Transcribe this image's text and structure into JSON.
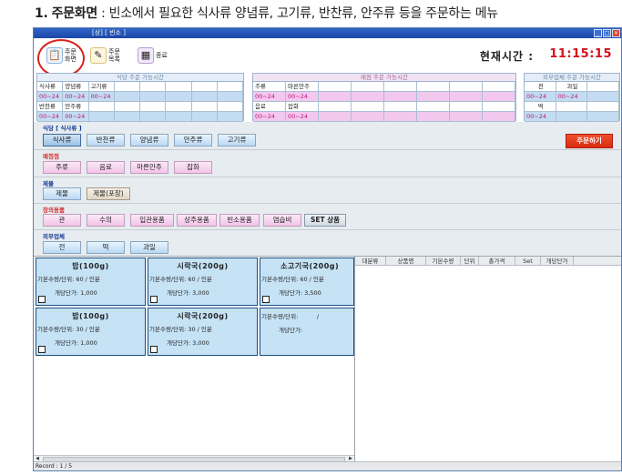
{
  "caption": {
    "number": "1.",
    "title": "주문화면",
    "separator": " : ",
    "description": "빈소에서 필요한 식사류 양념류, 고기류, 반찬류, 안주류 등을 주문하는 메뉴"
  },
  "window": {
    "title": "[상] [ 빈소 ]",
    "controls": [
      "_",
      "□",
      "×"
    ]
  },
  "toolbar": {
    "items": [
      {
        "line1": "주문",
        "line2": "화면",
        "icon": "order-screen-icon"
      },
      {
        "line1": "주문",
        "line2": "목록",
        "icon": "order-list-icon"
      },
      {
        "line1": "종료",
        "line2": "",
        "icon": "exit-icon"
      }
    ],
    "clock_label": "현재시간 :",
    "clock_value": "11:15:15"
  },
  "availability": [
    {
      "title": "식당 주문 가능시간",
      "rows": [
        [
          {
            "label": "식사류",
            "time": "00~24"
          },
          {
            "label": "양념류",
            "time": "00~24"
          },
          {
            "label": "고기류",
            "time": "00~24"
          }
        ],
        [
          {
            "label": "반찬류",
            "time": "00~24"
          },
          {
            "label": "안주류",
            "time": "00~24"
          }
        ]
      ]
    },
    {
      "title": "매점 주문 가능시간",
      "rows": [
        [
          {
            "label": "주류",
            "time": "00~24"
          },
          {
            "label": "마른안주",
            "time": "00~24"
          }
        ],
        [
          {
            "label": "음료",
            "time": "00~24"
          },
          {
            "label": "잡화",
            "time": "00~24"
          }
        ]
      ]
    },
    {
      "title": "외부업체 주문 가능시간",
      "rows": [
        [
          {
            "label": "전",
            "time": "00~24"
          },
          {
            "label": "과일",
            "time": "00~24"
          }
        ],
        [
          {
            "label": "떡",
            "time": "00~24"
          }
        ]
      ]
    }
  ],
  "menu": {
    "restaurant": {
      "title": "식당 [ 식사류 ]",
      "buttons": [
        "식사류",
        "반찬류",
        "양념류",
        "안주류",
        "고기류"
      ]
    },
    "order_button": "주문하기",
    "store": {
      "title": "매점점",
      "buttons": [
        "주류",
        "음료",
        "마른안주",
        "잡화"
      ]
    },
    "product": {
      "title": "제물",
      "buttons": [
        "제물",
        "제물(포장)"
      ]
    },
    "funeral": {
      "title": "장의용품",
      "buttons": [
        "관",
        "수의",
        "입관용품",
        "상주용품",
        "빈소용품",
        "염습비",
        "SET 상품"
      ]
    },
    "external": {
      "title": "외부업체",
      "buttons": [
        "전",
        "떡",
        "과일"
      ]
    }
  },
  "products": [
    {
      "name": "밥(100g)",
      "line1": "기본수량/단위: 60 / 인분",
      "line2": "개당단가: 1,000"
    },
    {
      "name": "시락국(200g)",
      "line1": "기본수량/단위: 60 / 인분",
      "line2": "개당단가: 3,000"
    },
    {
      "name": "소고기국(200g)",
      "line1": "기본수량/단위: 60 / 인분",
      "line2": "개당단가: 3,500"
    },
    {
      "name": "밥(100g)",
      "line1": "기본수량/단위: 30 / 인분",
      "line2": "개당단가: 1,000"
    },
    {
      "name": "시락국(200g)",
      "line1": "기본수량/단위: 30 / 인분",
      "line2": "개당단가: 3,000"
    },
    {
      "name": "",
      "line1": "기본수량/단위:          /",
      "line2": "개당단가:"
    }
  ],
  "order_table": {
    "columns": [
      "대분류",
      "상품명",
      "기본수량",
      "단위",
      "총가격",
      "Set",
      "개당단가"
    ]
  },
  "status": {
    "record": "Record : 1 / 5"
  }
}
